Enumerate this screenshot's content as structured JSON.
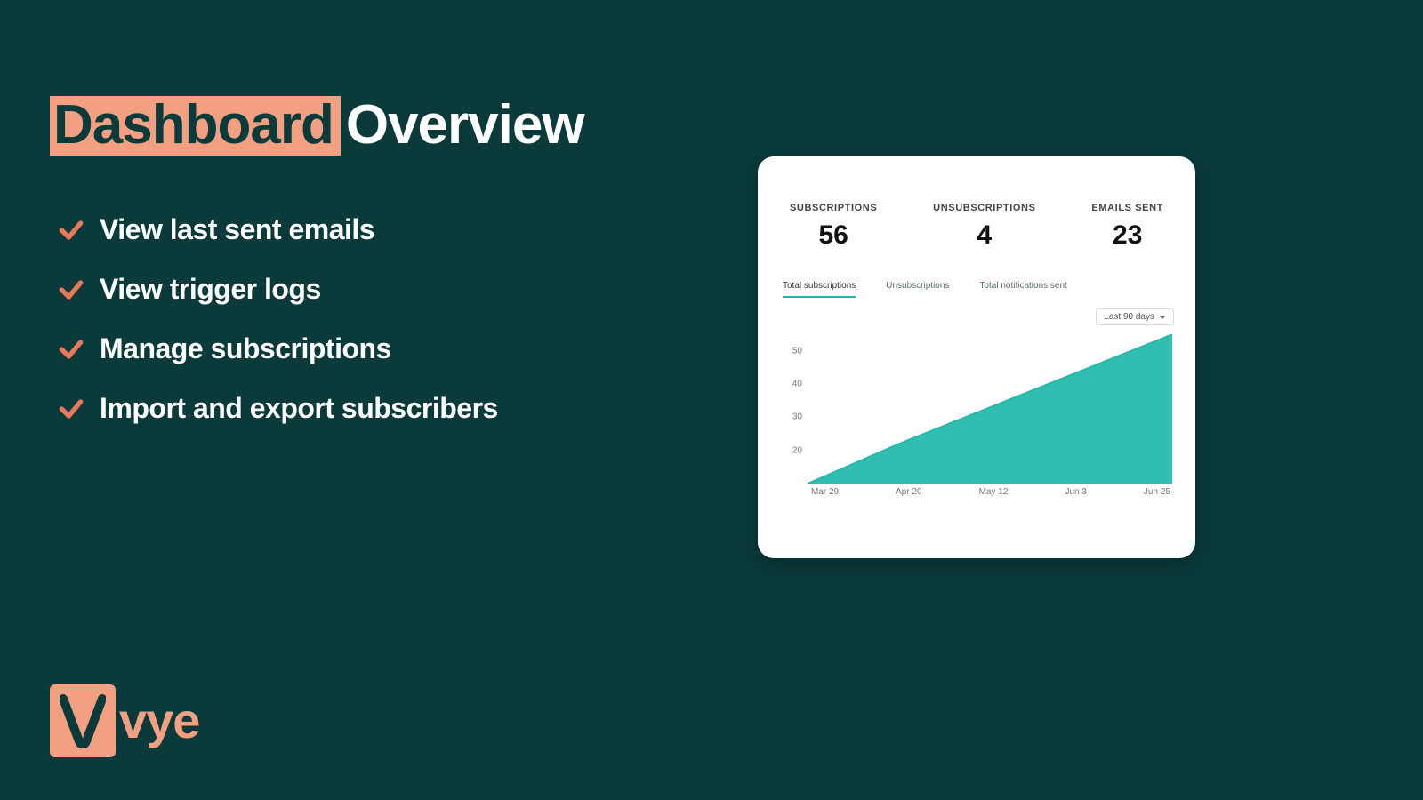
{
  "heading": {
    "highlight": "Dashboard",
    "rest": "Overview"
  },
  "features": [
    "View last sent emails",
    "View trigger logs",
    "Manage subscriptions",
    "Import and export subscribers"
  ],
  "logo": {
    "text": "vye"
  },
  "card": {
    "stats": [
      {
        "label": "SUBSCRIPTIONS",
        "value": "56"
      },
      {
        "label": "UNSUBSCRIPTIONS",
        "value": "4"
      },
      {
        "label": "EMAILS SENT",
        "value": "23"
      }
    ],
    "tabs": [
      {
        "label": "Total subscriptions",
        "active": true
      },
      {
        "label": "Unsubscriptions",
        "active": false
      },
      {
        "label": "Total notifications sent",
        "active": false
      }
    ],
    "range_label": "Last 90 days"
  },
  "chart_data": {
    "type": "area",
    "title": "",
    "xlabel": "",
    "ylabel": "",
    "ylim": [
      10,
      55
    ],
    "y_ticks": [
      50,
      40,
      30,
      20
    ],
    "x_ticks": [
      "Mar 29",
      "Apr 20",
      "May 12",
      "Jun 3",
      "Jun 25"
    ],
    "series": [
      {
        "name": "Total subscriptions",
        "color": "#1bb6a6",
        "x": [
          "Mar 29",
          "Apr 20",
          "May 12",
          "Jun 3",
          "Jun 25"
        ],
        "values": [
          10,
          22,
          33,
          44,
          55
        ]
      }
    ]
  }
}
